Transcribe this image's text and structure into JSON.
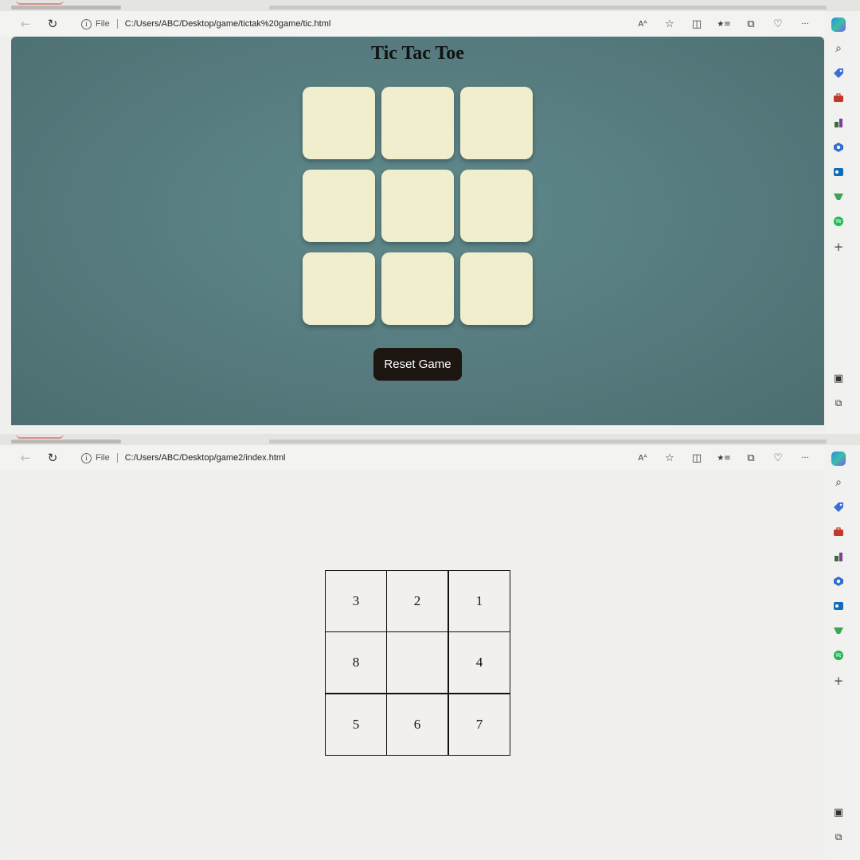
{
  "windows": [
    {
      "address": {
        "back_icon": "back-arrow-icon",
        "reload_glyph": "↻",
        "info_glyph": "i",
        "scheme": "File",
        "path": "C:/Users/ABC/Desktop/game/tictak%20game/tic.html"
      },
      "toolbar": {
        "read_aloud": "Aᴬ",
        "favorite": "☆",
        "split": "◫",
        "favorites": "★≡",
        "collections": "⧉",
        "heart": "♡",
        "more": "···"
      },
      "page": {
        "title": "Tic Tac Toe",
        "cells": [
          "",
          "",
          "",
          "",
          "",
          "",
          "",
          "",
          ""
        ],
        "reset_label": "Reset Game"
      }
    },
    {
      "address": {
        "back_icon": "back-arrow-icon",
        "reload_glyph": "↻",
        "info_glyph": "i",
        "scheme": "File",
        "path": "C:/Users/ABC/Desktop/game2/index.html"
      },
      "toolbar": {
        "read_aloud": "Aᴬ",
        "favorite": "☆",
        "split": "◫",
        "favorites": "★≡",
        "collections": "⧉",
        "heart": "♡",
        "more": "···"
      },
      "page": {
        "cells": [
          "3",
          "2",
          "1",
          "8",
          "",
          "4",
          "5",
          "6",
          "7"
        ]
      }
    }
  ],
  "sidebar": {
    "search": "⌕",
    "add": "+",
    "panel": "▣",
    "external": "⧉",
    "colors": {
      "shopping": "#3b6fd8",
      "tools": "#c0392b",
      "games": "#7b3fa0",
      "m365": "#2f6fd1",
      "outlook": "#0f6cbd",
      "drop": "#3aa655",
      "spotify": "#1db954"
    }
  },
  "colors": {
    "board_bg": "#577c7f",
    "cell_fill": "#f1eecd",
    "reset_bg": "#1c1510"
  }
}
